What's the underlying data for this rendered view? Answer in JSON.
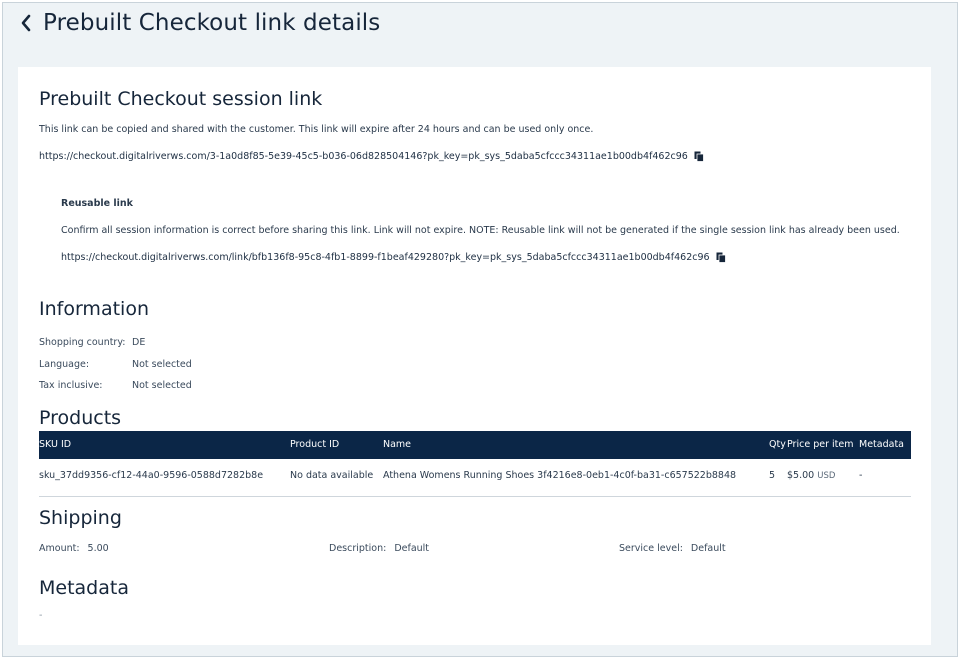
{
  "header": {
    "title": "Prebuilt Checkout link details"
  },
  "session": {
    "title": "Prebuilt Checkout session link",
    "description": "This link can be copied and shared with the customer. This link will expire after 24 hours and can be used only once.",
    "url": "https://checkout.digitalriverws.com/3-1a0d8f85-5e39-45c5-b036-06d828504146?pk_key=pk_sys_5daba5cfccc34311ae1b00db4f462c96"
  },
  "reusable": {
    "title": "Reusable link",
    "description": "Confirm all session information is correct before sharing this link. Link will not expire. NOTE: Reusable link will not be generated if the single session link has already been used.",
    "url": "https://checkout.digitalriverws.com/link/bfb136f8-95c8-4fb1-8899-f1beaf429280?pk_key=pk_sys_5daba5cfccc34311ae1b00db4f462c96"
  },
  "information": {
    "title": "Information",
    "rows": [
      {
        "label": "Shopping country:",
        "value": "DE"
      },
      {
        "label": "Language:",
        "value": "Not selected"
      },
      {
        "label": "Tax inclusive:",
        "value": "Not selected"
      }
    ]
  },
  "products": {
    "title": "Products",
    "columns": [
      "SKU ID",
      "Product ID",
      "Name",
      "Qty",
      "Price per item",
      "Metadata"
    ],
    "rows": [
      {
        "sku": "sku_37dd9356-cf12-44a0-9596-0588d7282b8e",
        "product_id": "No data available",
        "name": "Athena Womens Running Shoes 3f4216e8-0eb1-4c0f-ba31-c657522b8848",
        "qty": "5",
        "price": "$5.00",
        "currency": "USD",
        "metadata": "-"
      }
    ]
  },
  "shipping": {
    "title": "Shipping",
    "amount_label": "Amount:",
    "amount": "5.00",
    "description_label": "Description:",
    "description": "Default",
    "service_label": "Service level:",
    "service": "Default"
  },
  "metadata": {
    "title": "Metadata",
    "value": "-"
  },
  "colors": {
    "table_header": "#0b2647",
    "page_bg": "#eef3f6",
    "card_bg": "#ffffff"
  }
}
